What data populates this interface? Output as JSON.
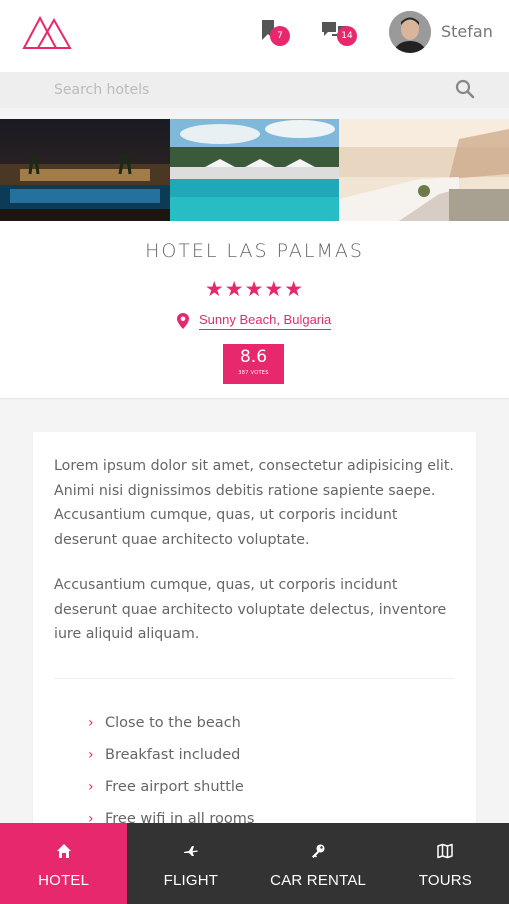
{
  "header": {
    "logo_icon": "mountain-triangle-logo",
    "bookmark_icon": "bookmark-icon",
    "bookmark_count": "7",
    "chat_icon": "chat-bubbles-icon",
    "chat_count": "14",
    "user_name": "Stefan"
  },
  "search": {
    "placeholder": "Search hotels",
    "value": "",
    "icon": "search-icon"
  },
  "gallery": {
    "images": [
      "night-pool-palms",
      "day-pool-umbrellas",
      "seaside-terrace-sunset"
    ]
  },
  "hotel": {
    "name": "HOTEL LAS PALMAS",
    "stars": "★★★★★",
    "location": "Sunny Beach, Bulgaria",
    "score": "8.6",
    "votes": "387 VOTES"
  },
  "description": {
    "paragraph1": "Lorem ipsum dolor sit amet, consectetur adipisicing elit. Animi nisi dignissimos debitis ratione sapiente saepe. Accusantium cumque, quas, ut corporis incidunt deserunt quae architecto voluptate.",
    "paragraph2": "Accusantium cumque, quas, ut corporis incidunt deserunt quae architecto voluptate delectus, inventore iure aliquid aliquam."
  },
  "features": [
    "Close to the beach",
    "Breakfast included",
    "Free airport shuttle",
    "Free wifi in all rooms"
  ],
  "bottom_nav": {
    "items": [
      {
        "label": "HOTEL",
        "icon": "home-icon",
        "active": true
      },
      {
        "label": "FLIGHT",
        "icon": "airplane-icon",
        "active": false
      },
      {
        "label": "CAR RENTAL",
        "icon": "key-icon",
        "active": false
      },
      {
        "label": "TOURS",
        "icon": "map-icon",
        "active": false
      }
    ]
  },
  "colors": {
    "accent": "#e8286c",
    "nav_bg": "#333333",
    "page_bg": "#f5f4f4"
  }
}
